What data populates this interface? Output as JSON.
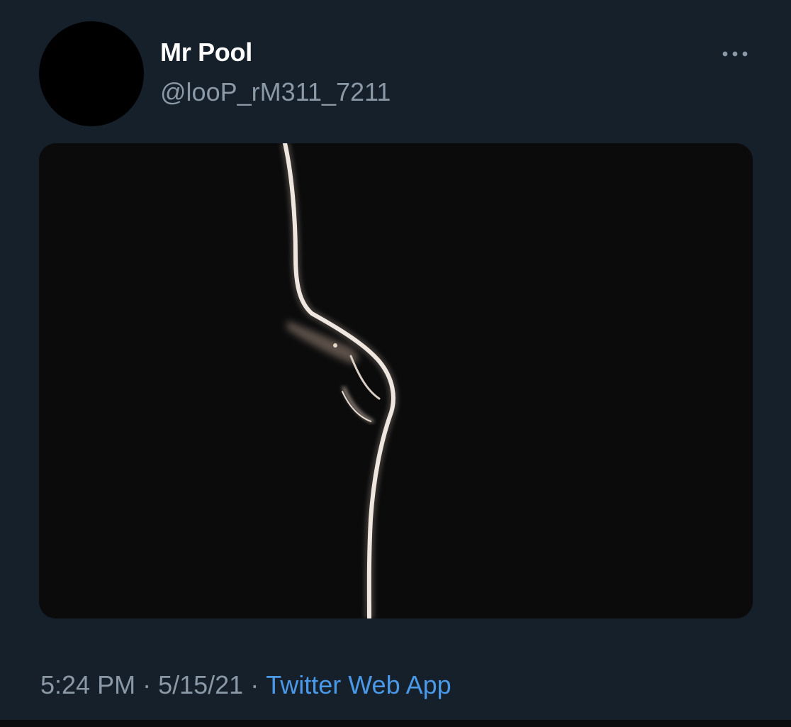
{
  "tweet": {
    "author": {
      "display_name": "Mr Pool",
      "handle": "@looP_rM311_7211",
      "avatar_color": "#000000"
    },
    "more_icon": "more-horizontal-icon",
    "media": {
      "background_color": "#0b0b0c"
    },
    "meta": {
      "time": "5:24 PM",
      "separator": "·",
      "date": "5/15/21",
      "source": "Twitter Web App"
    }
  },
  "colors": {
    "background": "#15202b",
    "primary_text": "#ffffff",
    "secondary_text": "#8b98a5",
    "link": "#4a99e9"
  }
}
